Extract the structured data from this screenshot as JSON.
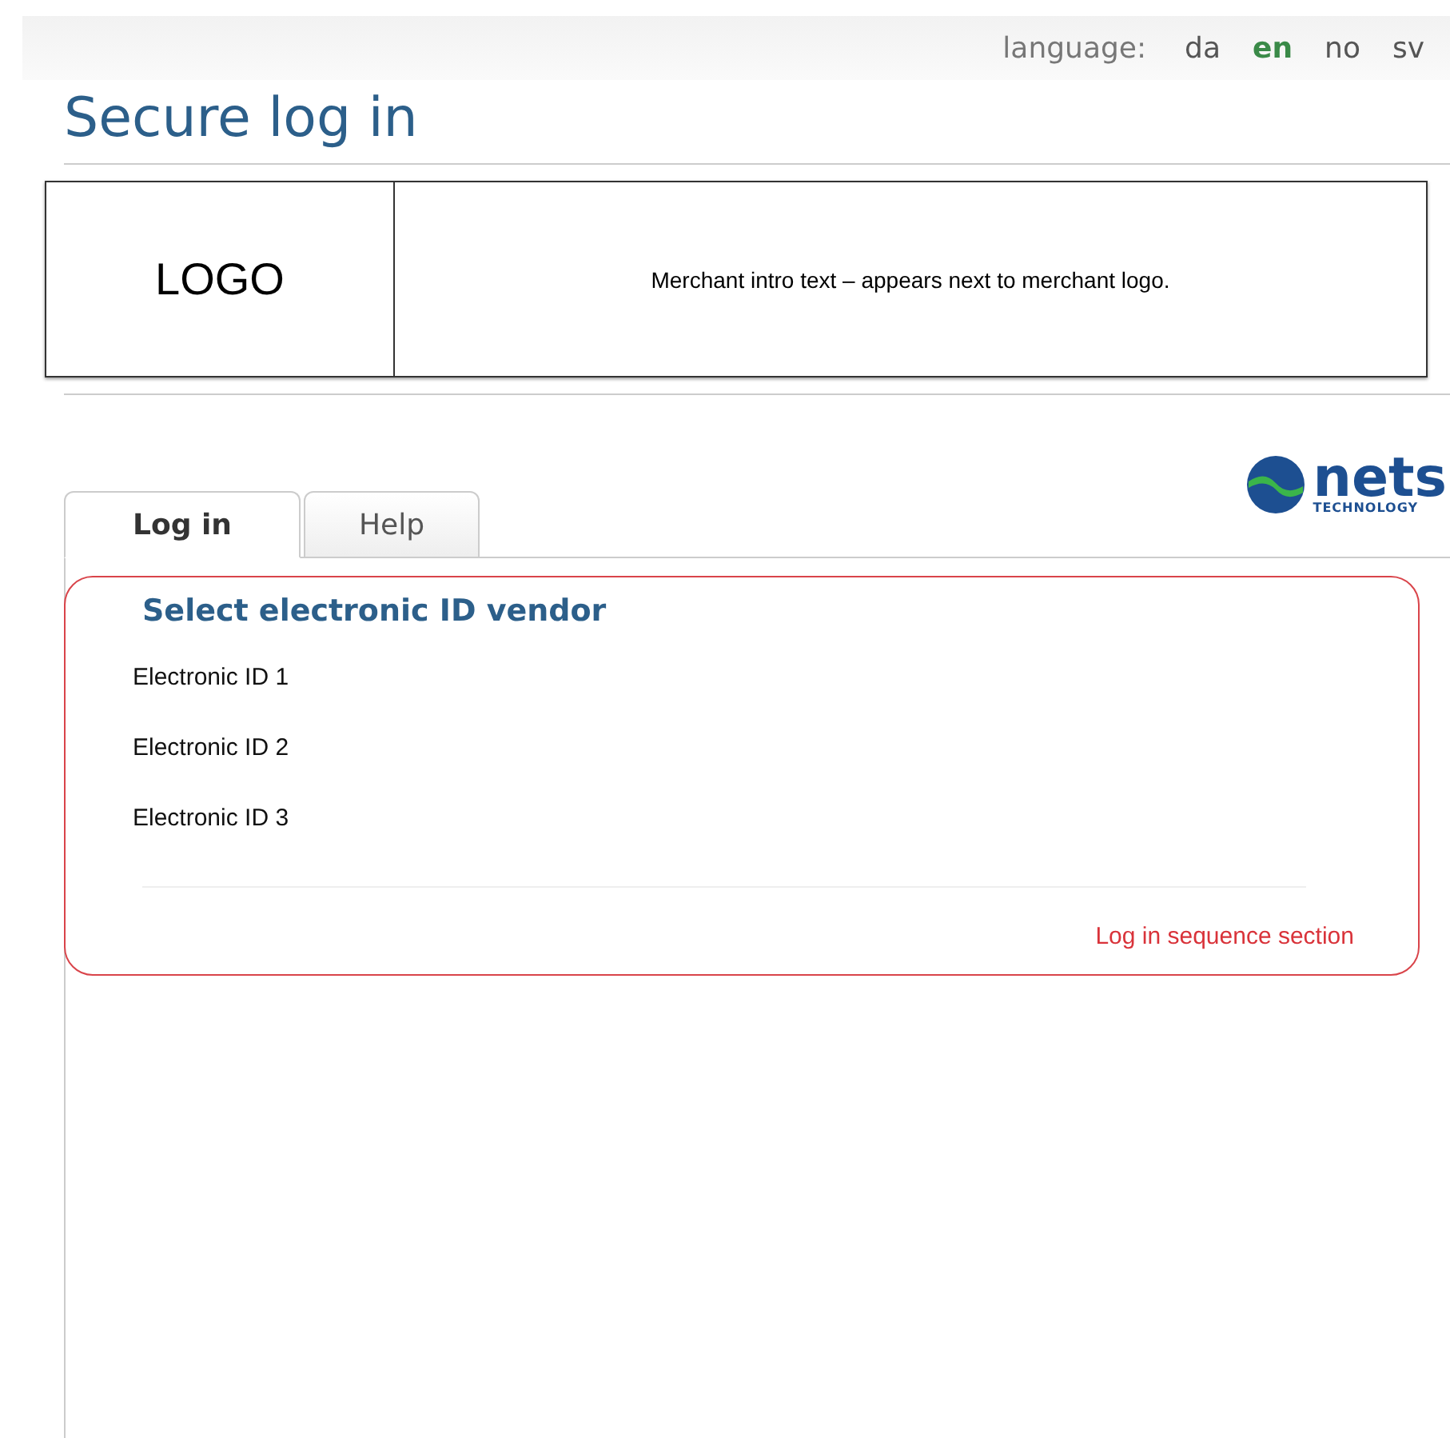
{
  "language_bar": {
    "label": "language:",
    "options": [
      {
        "label": "da",
        "selected": false
      },
      {
        "label": "en",
        "selected": true
      },
      {
        "label": "no",
        "selected": false
      },
      {
        "label": "sv",
        "selected": false
      }
    ]
  },
  "title": "Secure log in",
  "merchant": {
    "logo": "LOGO",
    "intro": "Merchant intro text – appears next to merchant logo."
  },
  "brand": {
    "name": "nets",
    "tagline": "TECHNOLOGY"
  },
  "tabs": [
    {
      "label": "Log in",
      "selected": true
    },
    {
      "label": "Help",
      "selected": false
    }
  ],
  "section": {
    "heading": "Select electronic ID vendor",
    "vendors": [
      "Electronic ID 1",
      "Electronic ID 2",
      "Electronic ID 3"
    ],
    "note": "Log in sequence section"
  }
}
